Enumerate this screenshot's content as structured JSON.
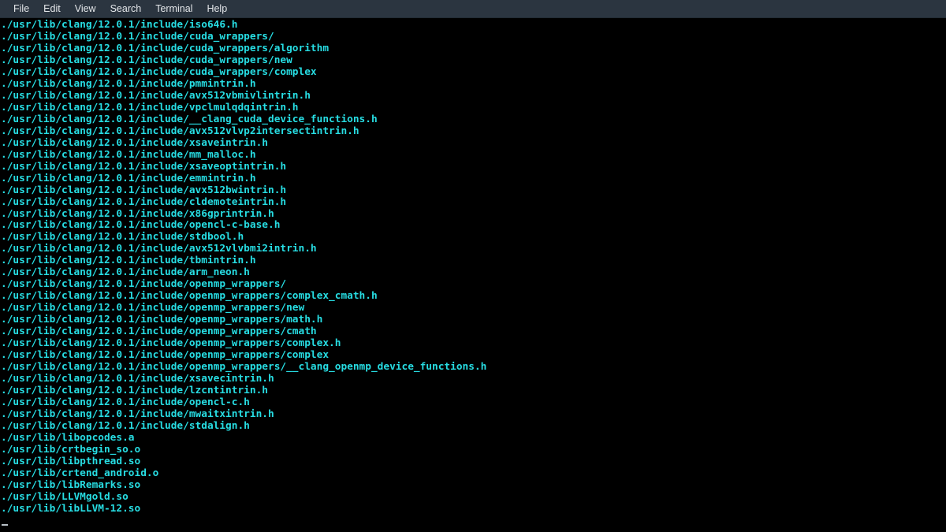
{
  "window": {
    "type": "terminal-emulator",
    "colors": {
      "menubar_background": "#2b3540",
      "menubar_text": "#e4e7ea",
      "terminal_background": "#000000",
      "terminal_text": "#27dde3",
      "cursor": "#b8c0c6"
    }
  },
  "menubar": {
    "items": [
      {
        "label": "File"
      },
      {
        "label": "Edit"
      },
      {
        "label": "View"
      },
      {
        "label": "Search"
      },
      {
        "label": "Terminal"
      },
      {
        "label": "Help"
      }
    ]
  },
  "terminal": {
    "lines": [
      "./usr/lib/clang/12.0.1/include/iso646.h",
      "./usr/lib/clang/12.0.1/include/cuda_wrappers/",
      "./usr/lib/clang/12.0.1/include/cuda_wrappers/algorithm",
      "./usr/lib/clang/12.0.1/include/cuda_wrappers/new",
      "./usr/lib/clang/12.0.1/include/cuda_wrappers/complex",
      "./usr/lib/clang/12.0.1/include/pmmintrin.h",
      "./usr/lib/clang/12.0.1/include/avx512vbmivlintrin.h",
      "./usr/lib/clang/12.0.1/include/vpclmulqdqintrin.h",
      "./usr/lib/clang/12.0.1/include/__clang_cuda_device_functions.h",
      "./usr/lib/clang/12.0.1/include/avx512vlvp2intersectintrin.h",
      "./usr/lib/clang/12.0.1/include/xsaveintrin.h",
      "./usr/lib/clang/12.0.1/include/mm_malloc.h",
      "./usr/lib/clang/12.0.1/include/xsaveoptintrin.h",
      "./usr/lib/clang/12.0.1/include/emmintrin.h",
      "./usr/lib/clang/12.0.1/include/avx512bwintrin.h",
      "./usr/lib/clang/12.0.1/include/cldemoteintrin.h",
      "./usr/lib/clang/12.0.1/include/x86gprintrin.h",
      "./usr/lib/clang/12.0.1/include/opencl-c-base.h",
      "./usr/lib/clang/12.0.1/include/stdbool.h",
      "./usr/lib/clang/12.0.1/include/avx512vlvbmi2intrin.h",
      "./usr/lib/clang/12.0.1/include/tbmintrin.h",
      "./usr/lib/clang/12.0.1/include/arm_neon.h",
      "./usr/lib/clang/12.0.1/include/openmp_wrappers/",
      "./usr/lib/clang/12.0.1/include/openmp_wrappers/complex_cmath.h",
      "./usr/lib/clang/12.0.1/include/openmp_wrappers/new",
      "./usr/lib/clang/12.0.1/include/openmp_wrappers/math.h",
      "./usr/lib/clang/12.0.1/include/openmp_wrappers/cmath",
      "./usr/lib/clang/12.0.1/include/openmp_wrappers/complex.h",
      "./usr/lib/clang/12.0.1/include/openmp_wrappers/complex",
      "./usr/lib/clang/12.0.1/include/openmp_wrappers/__clang_openmp_device_functions.h",
      "./usr/lib/clang/12.0.1/include/xsavecintrin.h",
      "./usr/lib/clang/12.0.1/include/lzcntintrin.h",
      "./usr/lib/clang/12.0.1/include/opencl-c.h",
      "./usr/lib/clang/12.0.1/include/mwaitxintrin.h",
      "./usr/lib/clang/12.0.1/include/stdalign.h",
      "./usr/lib/libopcodes.a",
      "./usr/lib/crtbegin_so.o",
      "./usr/lib/libpthread.so",
      "./usr/lib/crtend_android.o",
      "./usr/lib/libRemarks.so",
      "./usr/lib/LLVMgold.so",
      "./usr/lib/libLLVM-12.so"
    ]
  }
}
